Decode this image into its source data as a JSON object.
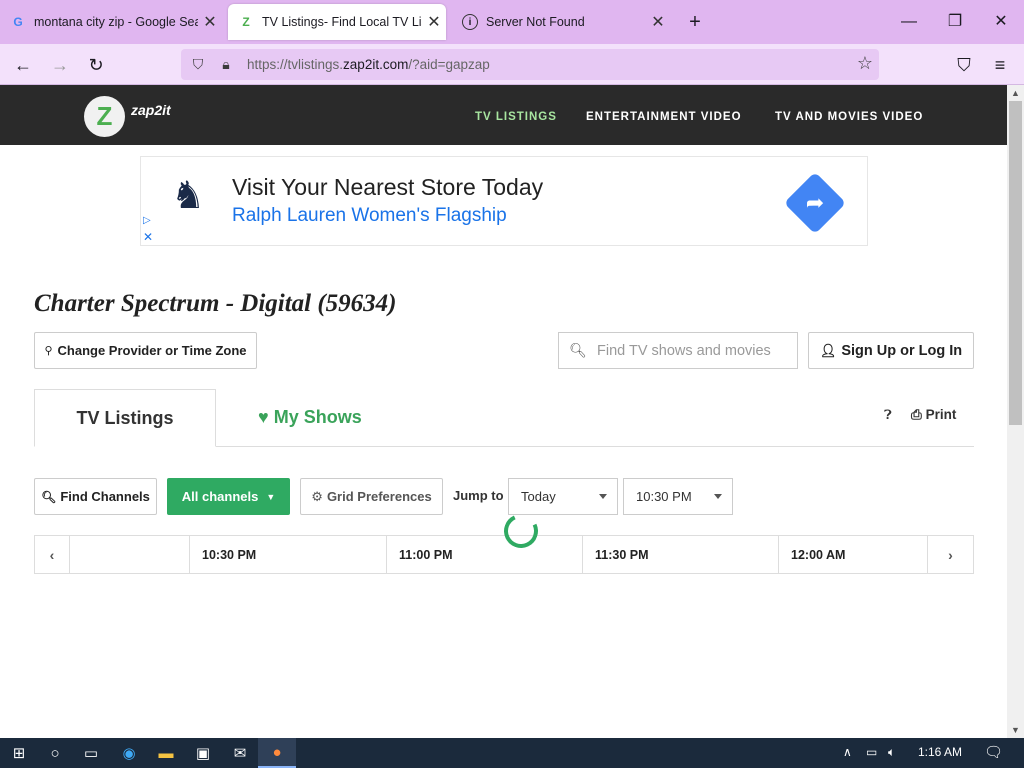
{
  "browser": {
    "tabs": [
      {
        "title": "montana city zip - Google Search",
        "favicon": "G"
      },
      {
        "title": "TV Listings- Find Local TV Listings",
        "favicon": "Z"
      },
      {
        "title": "Server Not Found",
        "favicon": "i"
      }
    ],
    "url_prefix": "https://tvlistings.",
    "url_domain": "zap2it.com",
    "url_suffix": "/?aid=gapzap"
  },
  "site": {
    "logo_letter": "Z",
    "logo_text": "zap2it",
    "nav": [
      "TV LISTINGS",
      "ENTERTAINMENT VIDEO",
      "TV AND MOVIES VIDEO"
    ]
  },
  "ad": {
    "headline": "Visit Your Nearest Store Today",
    "subline": "Ralph Lauren Women's Flagship"
  },
  "main": {
    "heading": "Charter Spectrum - Digital (59634)",
    "change_provider": "Change Provider or Time Zone",
    "search_placeholder": "Find TV shows and movies",
    "signup": "Sign Up or Log In",
    "tab_listings": "TV Listings",
    "tab_myshows": "My Shows",
    "print": "Print",
    "find_channels": "Find Channels",
    "all_channels": "All channels",
    "grid_prefs": "Grid Preferences",
    "jump_to": "Jump to",
    "day_value": "Today",
    "time_value": "10:30 PM",
    "time_slots": [
      "10:30 PM",
      "11:00 PM",
      "11:30 PM",
      "12:00 AM"
    ]
  },
  "taskbar": {
    "time": "1:16 AM"
  },
  "colors": {
    "accent_green": "#2faa62",
    "header_bg": "#2a2a2a",
    "tabbar_bg": "#e0b6f0"
  }
}
